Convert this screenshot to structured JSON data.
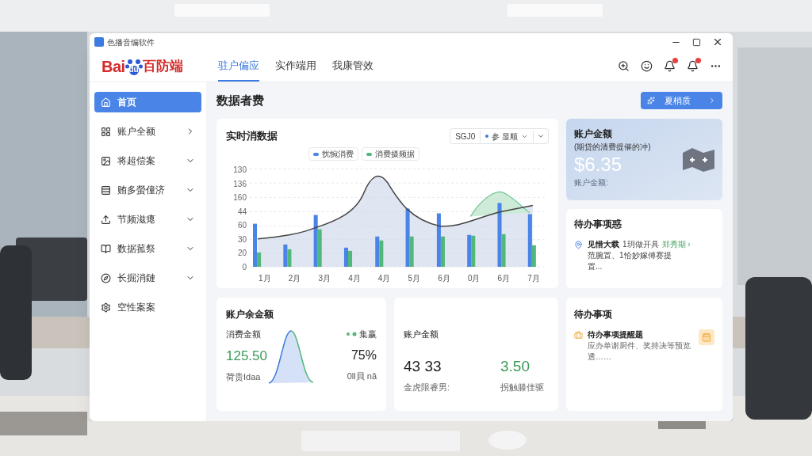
{
  "window": {
    "title": "色播音编软件"
  },
  "logo": {
    "latin": "Bai",
    "paw": "du",
    "cjk": "百防端"
  },
  "tabs": [
    {
      "label": "驻户偏应",
      "selected": true
    },
    {
      "label": "实作端用",
      "selected": false
    },
    {
      "label": "我康管效",
      "selected": false
    }
  ],
  "sidebar": {
    "items": [
      {
        "label": "首页",
        "kind": "plain",
        "selected": true
      },
      {
        "label": "账户全额",
        "kind": "link",
        "selected": false
      },
      {
        "label": "将超偿案",
        "kind": "group",
        "selected": false
      },
      {
        "label": "贿多螢僮济",
        "kind": "group",
        "selected": false
      },
      {
        "label": "节频滋瘪",
        "kind": "group",
        "selected": false
      },
      {
        "label": "数据菰祭",
        "kind": "group",
        "selected": false
      },
      {
        "label": "长掘消鏈",
        "kind": "group",
        "selected": false
      },
      {
        "label": "空性案案",
        "kind": "plain",
        "selected": false
      }
    ]
  },
  "page": {
    "title": "数据者费",
    "action_button": "夏梢质"
  },
  "chart_card": {
    "title": "实时消数据",
    "filter": {
      "range": "SGJ0",
      "option": "参 显顺"
    },
    "legend": [
      {
        "label": "扰惋消费",
        "color": "#4a84e6"
      },
      {
        "label": "消费摄频据",
        "color": "#52b77a"
      }
    ],
    "y_labels": [
      "130",
      "136",
      "160",
      "44",
      "60",
      "30",
      "20",
      "0"
    ],
    "x_labels": [
      "1月",
      "2月",
      "3月",
      "4月",
      "4月",
      "5月",
      "6月",
      "0月",
      "6月",
      "7月"
    ]
  },
  "balance_card": {
    "title": "账户金额",
    "subtitle": "(期贷的清费提催的冲)",
    "amount": "$6.35",
    "caption": "账户金额:"
  },
  "todo_card": {
    "title": "待办事项惑",
    "item": {
      "title": "见惜大载",
      "text": "1玥做开具",
      "link": "郑秀期 ›",
      "body": "范腕置、1恰妙嫁傅赛提置..."
    }
  },
  "spend_card": {
    "title": "账户余金额",
    "label": "消费金额",
    "legend": "集赢",
    "value": "125.50",
    "value_caption": "荷贵Idaa",
    "percent": "75%",
    "percent_caption": "0ll貝 nâ"
  },
  "amount_card": {
    "title": "账户金额",
    "left_value": "43 33",
    "left_caption": "金虎限睿男:",
    "right_value": "3.50",
    "right_caption": "拐触滕佳驱"
  },
  "todo_card_2": {
    "title": "待办事项",
    "item": {
      "title": "待办事项提醒题",
      "body": "应办单谢厨件、奖持决等预览透……"
    }
  }
}
